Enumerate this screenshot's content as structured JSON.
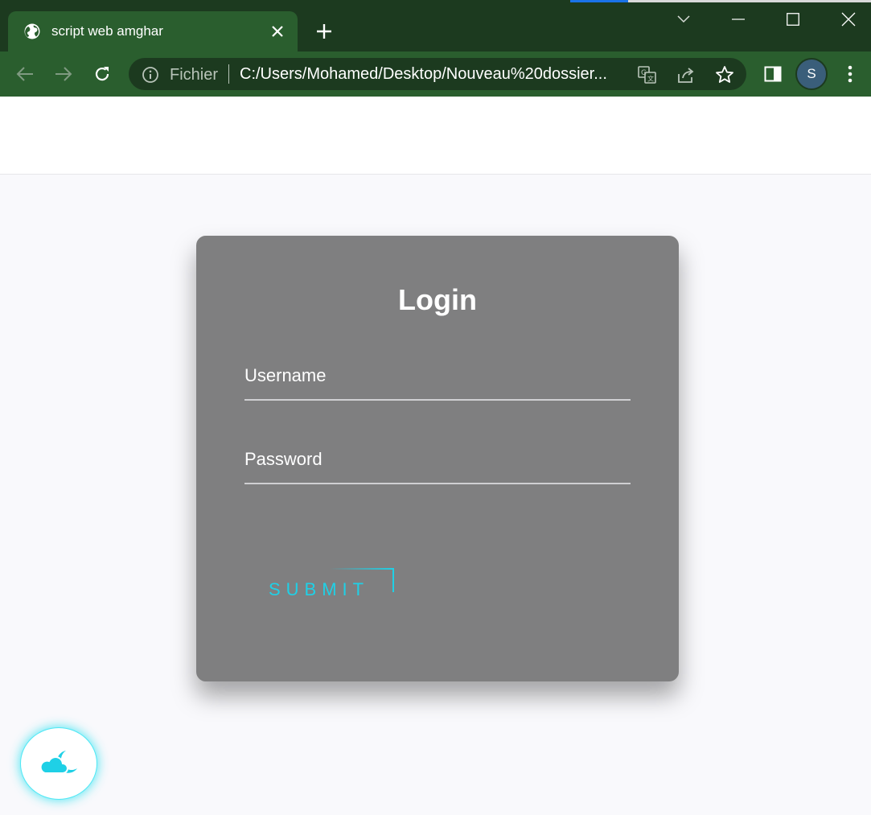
{
  "browser": {
    "tab_title": "script web amghar",
    "omnibox_scheme": "Fichier",
    "url": "C:/Users/Mohamed/Desktop/Nouveau%20dossier...",
    "profile_initial": "S"
  },
  "login": {
    "title": "Login",
    "username_label": "Username",
    "password_label": "Password",
    "submit_label": "SUBMIT"
  },
  "colors": {
    "chrome_dark": "#1c3a1f",
    "chrome_tab": "#2a5e2e",
    "card": "#7f7f80",
    "accent_cyan": "#1fd0e6",
    "page_bg": "#f9f9fc"
  },
  "icons": [
    "globe-icon",
    "close-icon",
    "plus-icon",
    "chevron-down-icon",
    "minimize-icon",
    "maximize-icon",
    "window-close-icon",
    "back-arrow-icon",
    "forward-arrow-icon",
    "reload-icon",
    "info-icon",
    "translate-icon",
    "share-icon",
    "star-icon",
    "side-panel-icon",
    "kebab-menu-icon",
    "cloud-moon-icon"
  ]
}
